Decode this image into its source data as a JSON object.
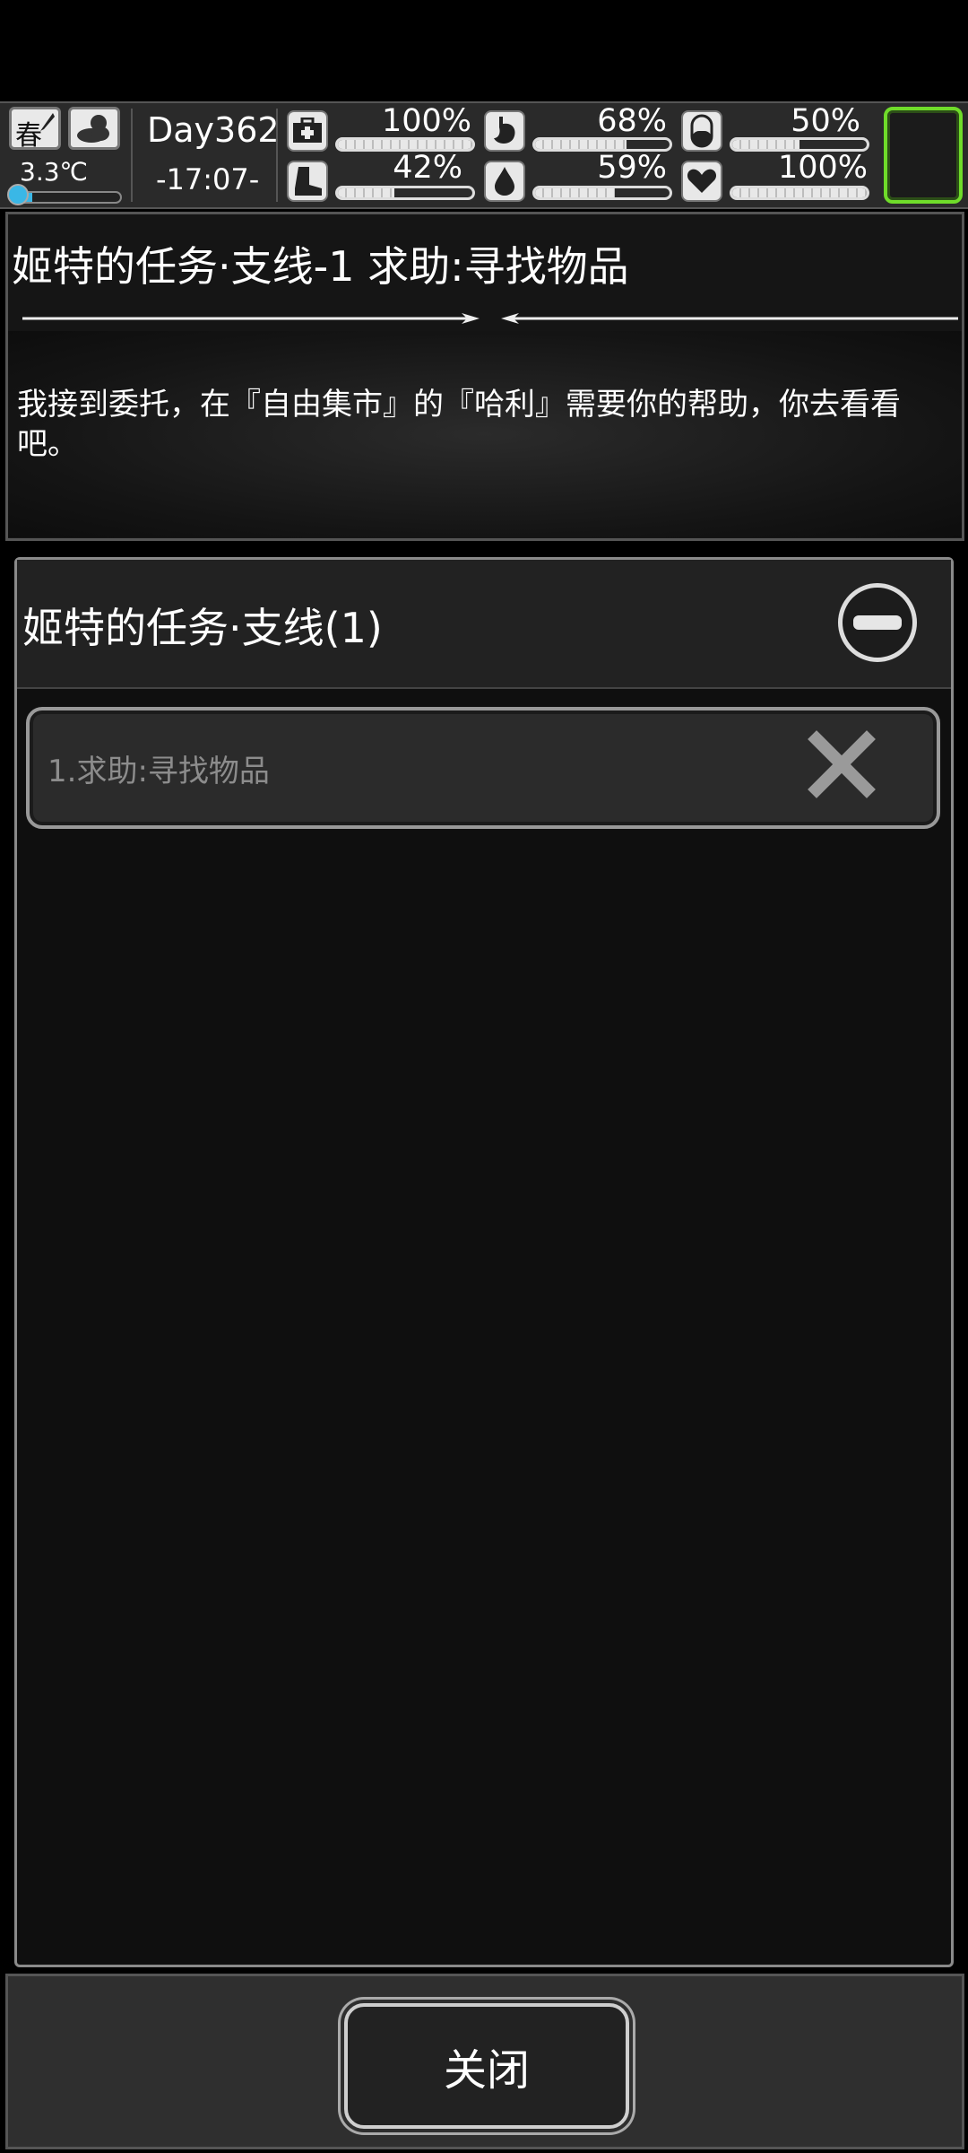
{
  "hud": {
    "season": "春",
    "temperature": "3.3℃",
    "temperature_level": 0.2,
    "day": "Day362",
    "time": "-17:07-",
    "stats": [
      {
        "icon": "medkit-icon",
        "value": "100%",
        "level": 1.0
      },
      {
        "icon": "stomach-icon",
        "value": "68%",
        "level": 0.68
      },
      {
        "icon": "pill-icon",
        "value": "50%",
        "level": 0.5
      },
      {
        "icon": "boot-icon",
        "value": "42%",
        "level": 0.42
      },
      {
        "icon": "water-drop-icon",
        "value": "59%",
        "level": 0.59
      },
      {
        "icon": "heart-icon",
        "value": "100%",
        "level": 1.0
      }
    ]
  },
  "task": {
    "title": "姬特的任务·支线-1 求助:寻找物品",
    "description": "我接到委托，在『自由集市』的『哈利』需要你的帮助，你去看看吧。"
  },
  "list": {
    "title": "姬特的任务·支线(1)",
    "items": [
      {
        "label": "1.求助:寻找物品"
      }
    ]
  },
  "footer": {
    "close_label": "关闭"
  },
  "colors": {
    "accent_green": "#6fdc2a",
    "temp_blue": "#3ab7e6"
  }
}
